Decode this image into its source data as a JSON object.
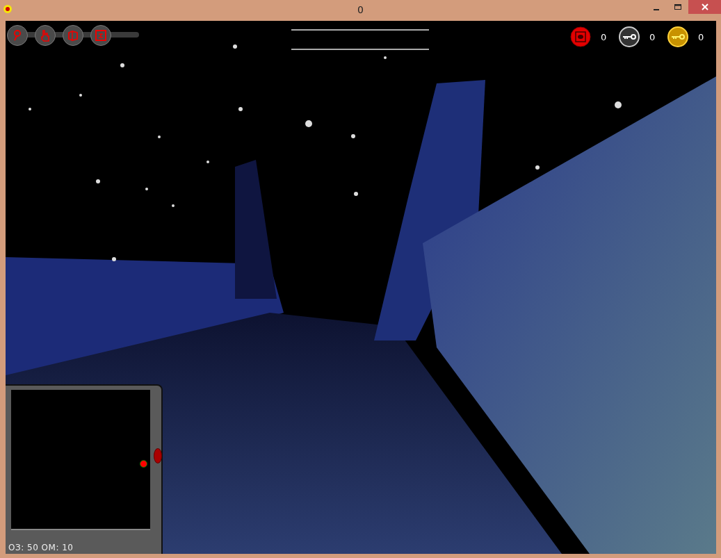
{
  "window": {
    "title": "0"
  },
  "hud": {
    "counters": [
      {
        "kind": "charm",
        "value": "0"
      },
      {
        "kind": "silver_key",
        "value": "0"
      },
      {
        "kind": "gold_key",
        "value": "0"
      }
    ],
    "stats": "ОЗ: 50 ОМ: 10"
  }
}
